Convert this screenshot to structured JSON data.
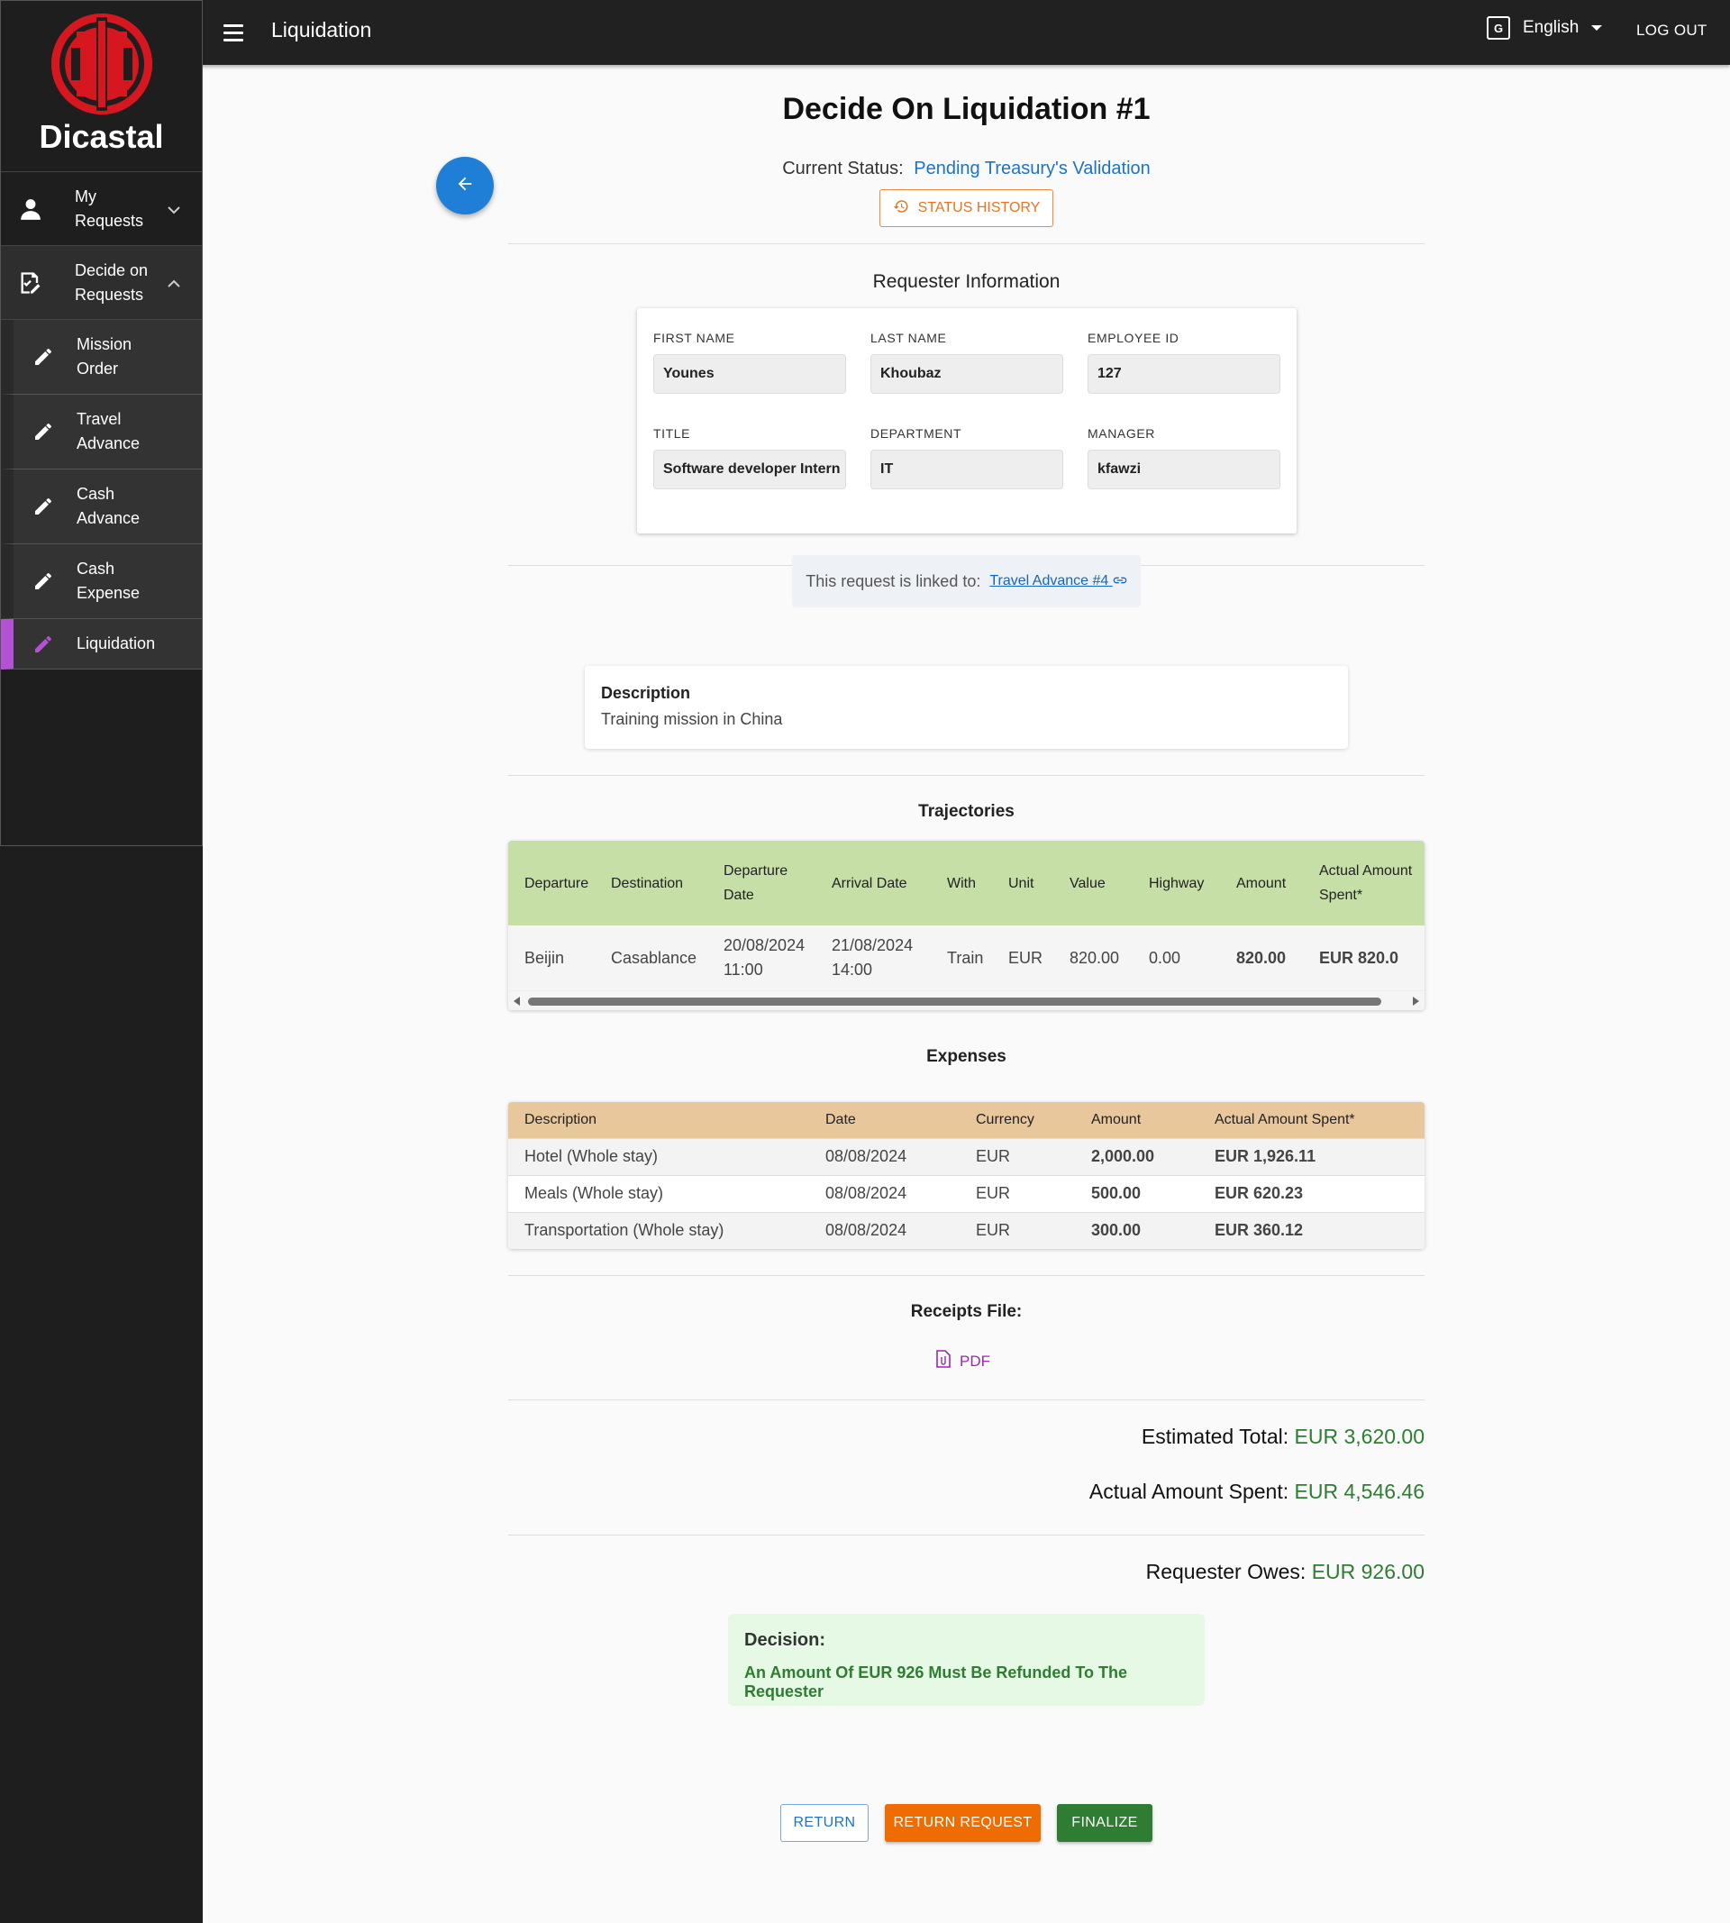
{
  "topbar": {
    "title": "Liquidation",
    "language": "English",
    "logout": "LOG OUT"
  },
  "brand": {
    "name": "Dicastal"
  },
  "sidebar": {
    "items": [
      {
        "label": "My Requests",
        "icon": "person-icon"
      },
      {
        "label": "Decide on Requests",
        "icon": "approve-document-icon"
      }
    ],
    "subitems": [
      {
        "label": "Mission Order",
        "icon": "pencil-icon"
      },
      {
        "label": "Travel Advance",
        "icon": "pencil-icon"
      },
      {
        "label": "Cash Advance",
        "icon": "pencil-icon"
      },
      {
        "label": "Cash Expense",
        "icon": "pencil-icon"
      },
      {
        "label": "Liquidation",
        "icon": "pencil-icon",
        "active": true
      }
    ]
  },
  "page": {
    "title": "Decide On Liquidation #1",
    "status_label": "Current Status:",
    "status_value": "Pending Treasury's Validation",
    "status_history": "STATUS HISTORY"
  },
  "requester": {
    "title": "Requester Information",
    "first_name_label": "FIRST NAME",
    "first_name": "Younes",
    "last_name_label": "LAST NAME",
    "last_name": "Khoubaz",
    "employee_id_label": "EMPLOYEE ID",
    "employee_id": "127",
    "title_label": "TITLE",
    "job_title": "Software developer Intern",
    "department_label": "DEPARTMENT",
    "department": "IT",
    "manager_label": "MANAGER",
    "manager": "kfawzi"
  },
  "linked": {
    "text": "This request is linked to:",
    "link": "Travel Advance #4"
  },
  "description": {
    "label": "Description",
    "value": "Training mission in China"
  },
  "trajectories": {
    "title": "Trajectories",
    "headers": [
      "Departure",
      "Destination",
      "Departure Date",
      "Arrival Date",
      "With",
      "Unit",
      "Value",
      "Highway",
      "Amount",
      "Actual Amount Spent*"
    ],
    "rows": [
      [
        "Beijin",
        "Casablance",
        "20/08/2024 11:00",
        "21/08/2024 14:00",
        "Train",
        "EUR",
        "820.00",
        "0.00",
        "820.00",
        "EUR 820.0"
      ]
    ]
  },
  "expenses": {
    "title": "Expenses",
    "headers": [
      "Description",
      "Date",
      "Currency",
      "Amount",
      "Actual Amount Spent*"
    ],
    "rows": [
      [
        "Hotel (Whole stay)",
        "08/08/2024",
        "EUR",
        "2,000.00",
        "EUR 1,926.11"
      ],
      [
        "Meals (Whole stay)",
        "08/08/2024",
        "EUR",
        "500.00",
        "EUR 620.23"
      ],
      [
        "Transportation (Whole stay)",
        "08/08/2024",
        "EUR",
        "300.00",
        "EUR 360.12"
      ]
    ]
  },
  "receipts": {
    "title": "Receipts File:",
    "file": "PDF"
  },
  "totals": {
    "estimated_label": "Estimated Total:",
    "estimated_value": "EUR 3,620.00",
    "actual_label": "Actual Amount Spent:",
    "actual_value": "EUR 4,546.46",
    "owes_label": "Requester Owes:",
    "owes_value": "EUR 926.00"
  },
  "decision": {
    "label": "Decision:",
    "value": "An Amount Of EUR 926 Must Be Refunded To The Requester"
  },
  "actions": {
    "return": "RETURN",
    "return_request": "RETURN REQUEST",
    "finalize": "FINALIZE"
  },
  "colors": {
    "accent_blue": "#1a73c8",
    "orange": "#ef6c00",
    "green": "#2e7d32",
    "active_purple": "#b452d6"
  }
}
